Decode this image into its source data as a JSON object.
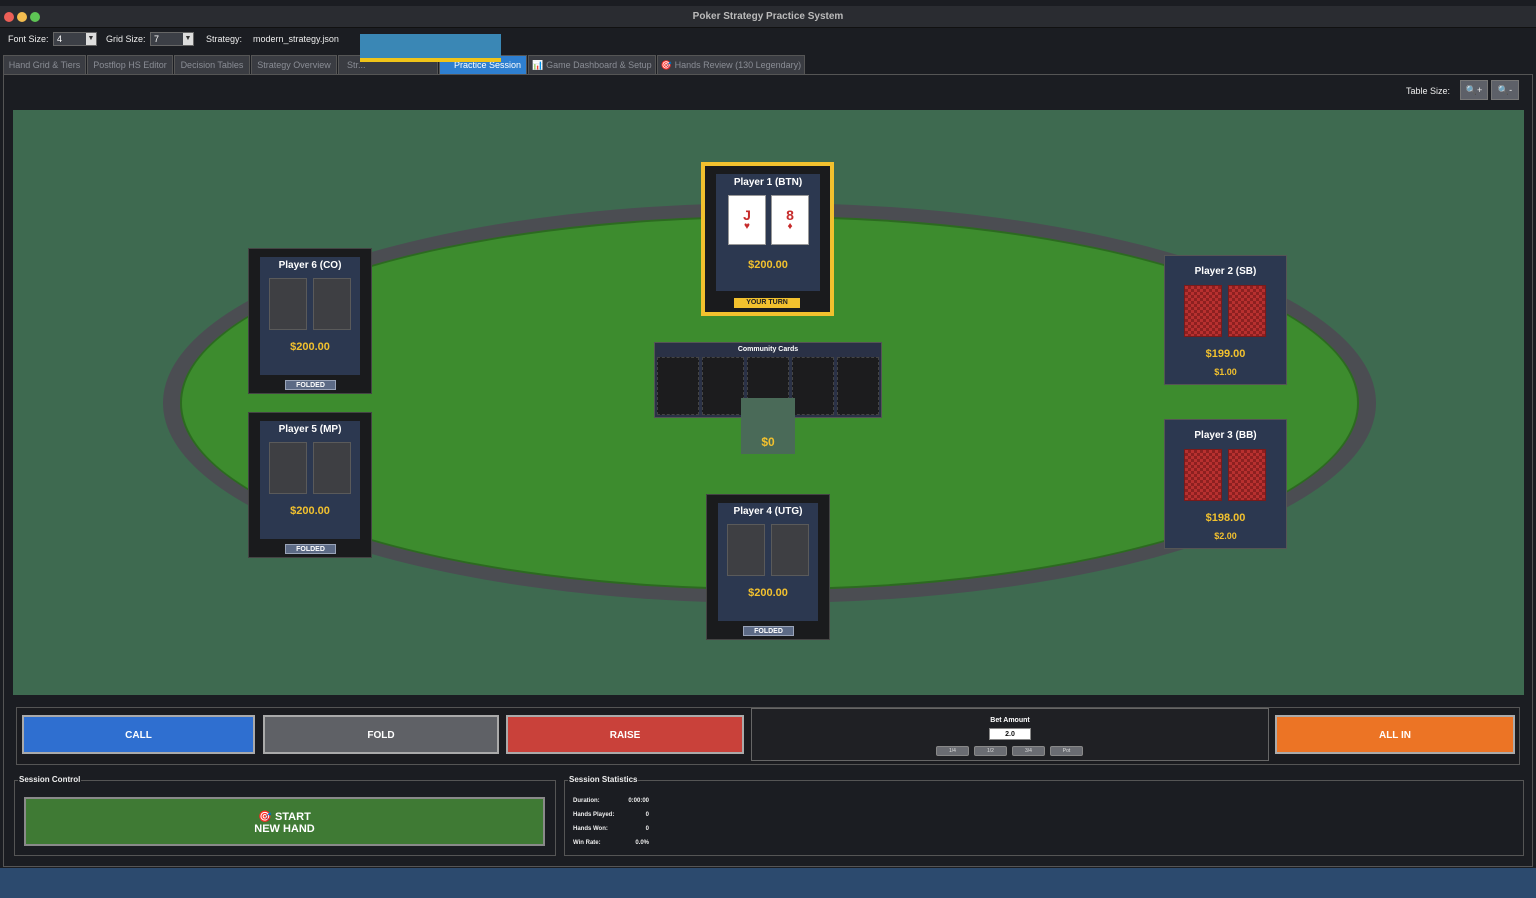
{
  "window": {
    "title": "Poker Strategy Practice System"
  },
  "toolbar": {
    "font_size_label": "Font Size:",
    "font_size_value": "4",
    "grid_size_label": "Grid Size:",
    "grid_size_value": "7",
    "strategy_label": "Strategy:",
    "strategy_value": "modern_strategy.json"
  },
  "tabs": [
    {
      "label": "Hand Grid & Tiers"
    },
    {
      "label": "Postflop HS Editor"
    },
    {
      "label": "Decision Tables"
    },
    {
      "label": "Strategy Overview"
    },
    {
      "label": "Str..."
    },
    {
      "label": "Practice Session",
      "active": true
    },
    {
      "label": "📊 Game Dashboard & Setup"
    },
    {
      "label": "🎯 Hands Review (130 Legendary)"
    }
  ],
  "table_size": {
    "label": "Table Size:",
    "zoom_in": "🔍+",
    "zoom_out": "🔍-"
  },
  "players": {
    "p1": {
      "name": "Player 1 (BTN)",
      "stack": "$200.00",
      "status": "YOUR TURN",
      "cards": [
        {
          "rank": "J",
          "suit": "♥"
        },
        {
          "rank": "8",
          "suit": "♦"
        }
      ]
    },
    "p2": {
      "name": "Player 2 (SB)",
      "stack": "$199.00",
      "bet": "$1.00"
    },
    "p3": {
      "name": "Player 3 (BB)",
      "stack": "$198.00",
      "bet": "$2.00"
    },
    "p4": {
      "name": "Player 4 (UTG)",
      "stack": "$200.00",
      "status": "FOLDED"
    },
    "p5": {
      "name": "Player 5 (MP)",
      "stack": "$200.00",
      "status": "FOLDED"
    },
    "p6": {
      "name": "Player 6 (CO)",
      "stack": "$200.00",
      "status": "FOLDED"
    }
  },
  "community": {
    "title": "Community Cards"
  },
  "pot": {
    "value": "$0"
  },
  "actions": {
    "call": "CALL",
    "fold": "FOLD",
    "raise": "RAISE",
    "all_in": "ALL IN",
    "bet_label": "Bet Amount",
    "bet_value": "2.0",
    "sizes": [
      "1/4",
      "1/2",
      "3/4",
      "Pot"
    ]
  },
  "colors": {
    "call": "#2f6fd0",
    "fold": "#5f6166",
    "raise": "#c9413a",
    "all_in": "#ec7425",
    "accent": "#f2c12e"
  },
  "session_control": {
    "title": "Session Control",
    "start_line1": "🎯 START",
    "start_line2": "NEW HAND"
  },
  "session_stats": {
    "title": "Session Statistics",
    "rows": [
      {
        "label": "Duration:",
        "value": "0:00:00"
      },
      {
        "label": "Hands Played:",
        "value": "0"
      },
      {
        "label": "Hands Won:",
        "value": "0"
      },
      {
        "label": "Win Rate:",
        "value": "0.0%"
      }
    ]
  }
}
